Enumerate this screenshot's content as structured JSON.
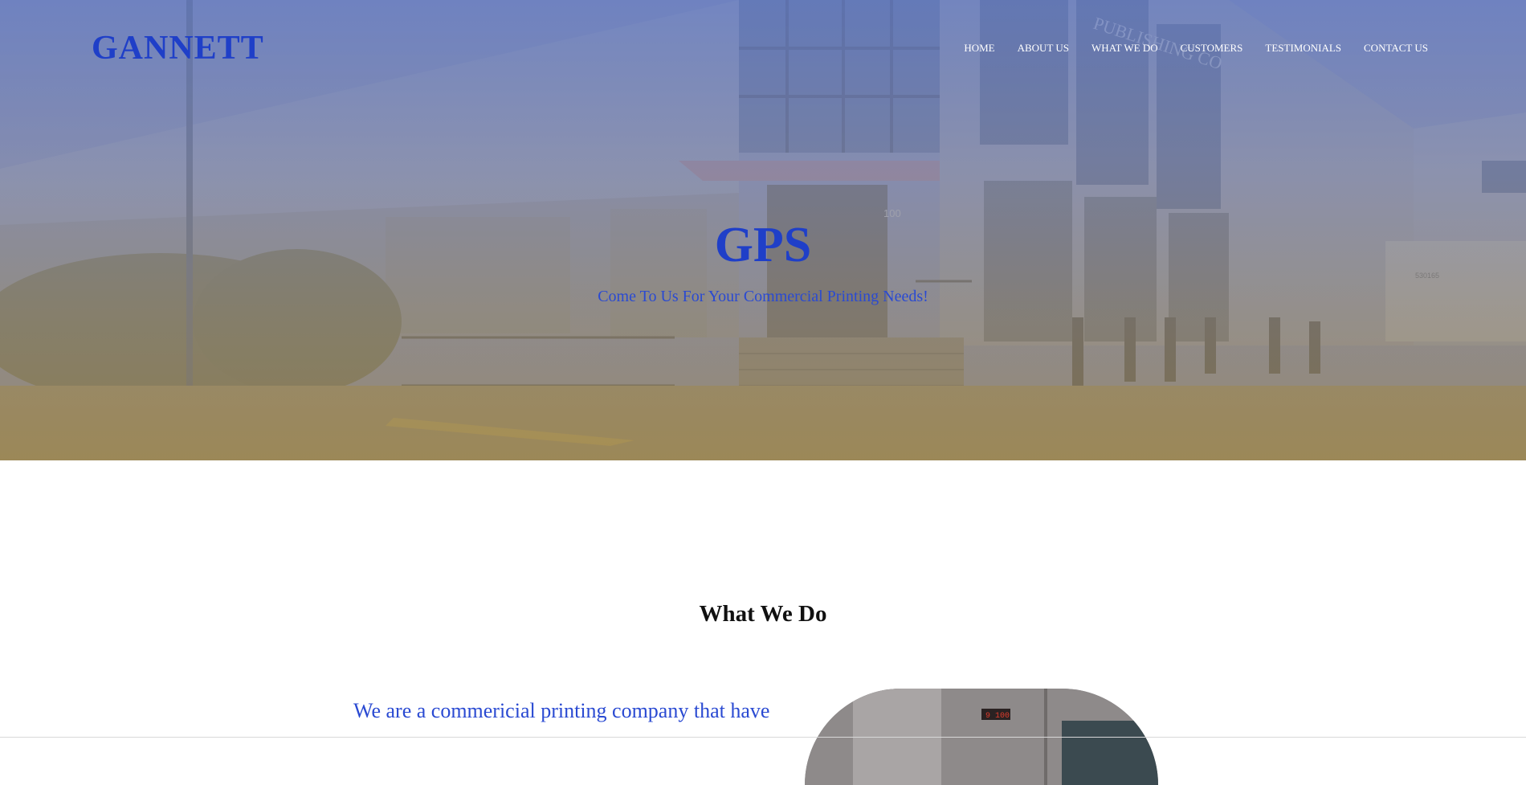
{
  "header": {
    "brand": "GANNETT",
    "nav": [
      {
        "label": "HOME"
      },
      {
        "label": "ABOUT US"
      },
      {
        "label": "WHAT WE DO"
      },
      {
        "label": "CUSTOMERS"
      },
      {
        "label": "TESTIMONIALS"
      },
      {
        "label": "CONTACT US"
      }
    ]
  },
  "hero": {
    "title": "GPS",
    "subtitle": "Come To Us For Your Commercial Printing Needs!",
    "photo_signage": "PUBLISHING CO",
    "photo_number": "100",
    "trailer_number": "530165"
  },
  "what_we_do": {
    "title": "What We Do",
    "intro": "We are a commericial printing company that have",
    "image_counter": "9 100"
  },
  "colors": {
    "brand_blue": "#1f3fc8",
    "nav_text": "#ffffff",
    "heading_text": "#111111"
  }
}
